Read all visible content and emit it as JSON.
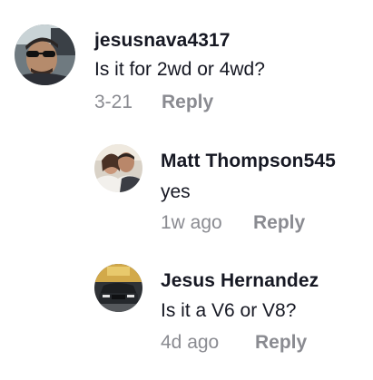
{
  "comments": [
    {
      "username": "jesusnava4317",
      "text": "Is it for 2wd or 4wd?",
      "date": "3-21",
      "reply_label": "Reply",
      "avatar_icon": "user-photo-sunglasses-car"
    },
    {
      "username": "Matt Thompson545",
      "text": "yes",
      "date": "1w ago",
      "reply_label": "Reply",
      "avatar_icon": "user-photo-couple"
    },
    {
      "username": "Jesus Hernandez",
      "text": "Is it a V6 or V8?",
      "date": "4d ago",
      "reply_label": "Reply",
      "avatar_icon": "user-photo-truck"
    }
  ],
  "colors": {
    "primary_text": "#161823",
    "secondary_text": "#8a8b91",
    "background": "#ffffff"
  }
}
